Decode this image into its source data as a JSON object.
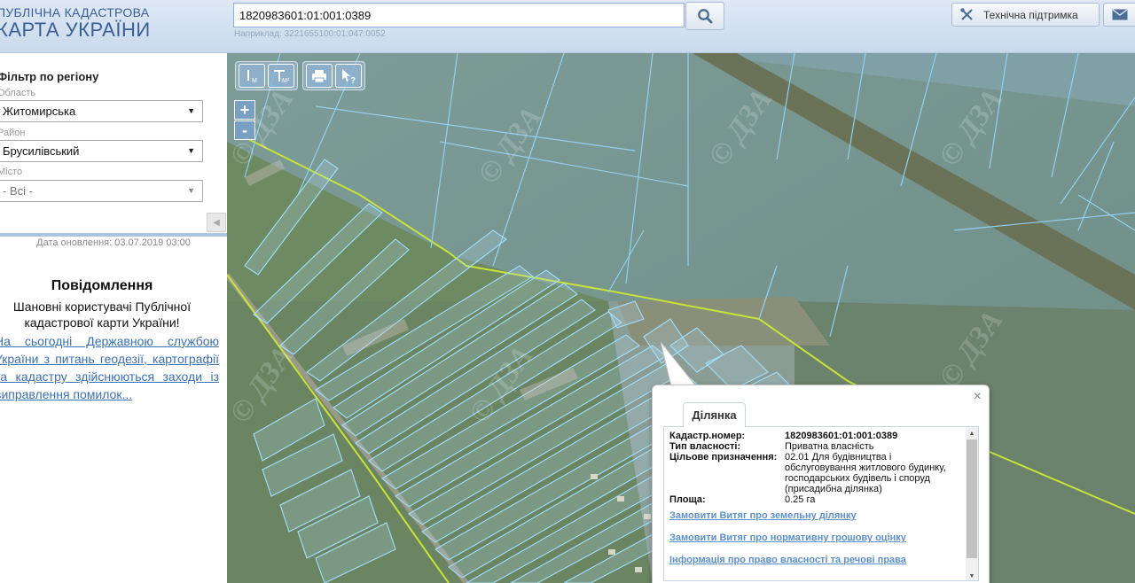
{
  "header": {
    "logo_line1": "ПУБЛІЧНА КАДАСТРОВА",
    "logo_line2": "КАРТА УКРАЇНИ",
    "search_value": "1820983601:01:001:0389",
    "search_hint": "Наприклад: 3221655100:01:047:0052",
    "support_label": "Технічна підтримка"
  },
  "sidebar": {
    "filter_title": "Фільтр по регіону",
    "oblast_label": "Область",
    "oblast_value": "Житомирська",
    "rayon_label": "Район",
    "rayon_value": "Брусилівський",
    "misto_label": "Місто",
    "misto_value": "- Всі -",
    "update_date": "Дата оновлення: 03.07.2019 03:00",
    "message_title": "Повідомлення",
    "message_body": "Шановні користувачі Публічної кадастрової карти України!",
    "message_link": "На сьогодні Державною службою України з питань геодезії, картографії та кадастру здійснюються заходи із виправлення помилок..."
  },
  "map": {
    "watermark": "© ДЗА",
    "zoom_in": "+",
    "zoom_out": "-"
  },
  "popup": {
    "close": "×",
    "tab": "Ділянка",
    "fields": [
      {
        "label": "Кадастр.номер:",
        "value": "1820983601:01:001:0389"
      },
      {
        "label": "Тип власності:",
        "value": "Приватна власність"
      },
      {
        "label": "Цільове призначення:",
        "value": "02.01 Для будівництва і обслуговування житлового будинку, господарських будівель і споруд (присадибна ділянка)"
      },
      {
        "label": "Площа:",
        "value": "0.25 га"
      }
    ],
    "links": [
      "Замовити Витяг про земельну ділянку",
      "Замовити Витяг про нормативну грошову оцінку",
      "Інформація про право власності та речові права"
    ]
  },
  "colors": {
    "parcel_stroke": "#8fd0f0",
    "boundary": "#c8e23a",
    "link": "#3b6fb6"
  }
}
